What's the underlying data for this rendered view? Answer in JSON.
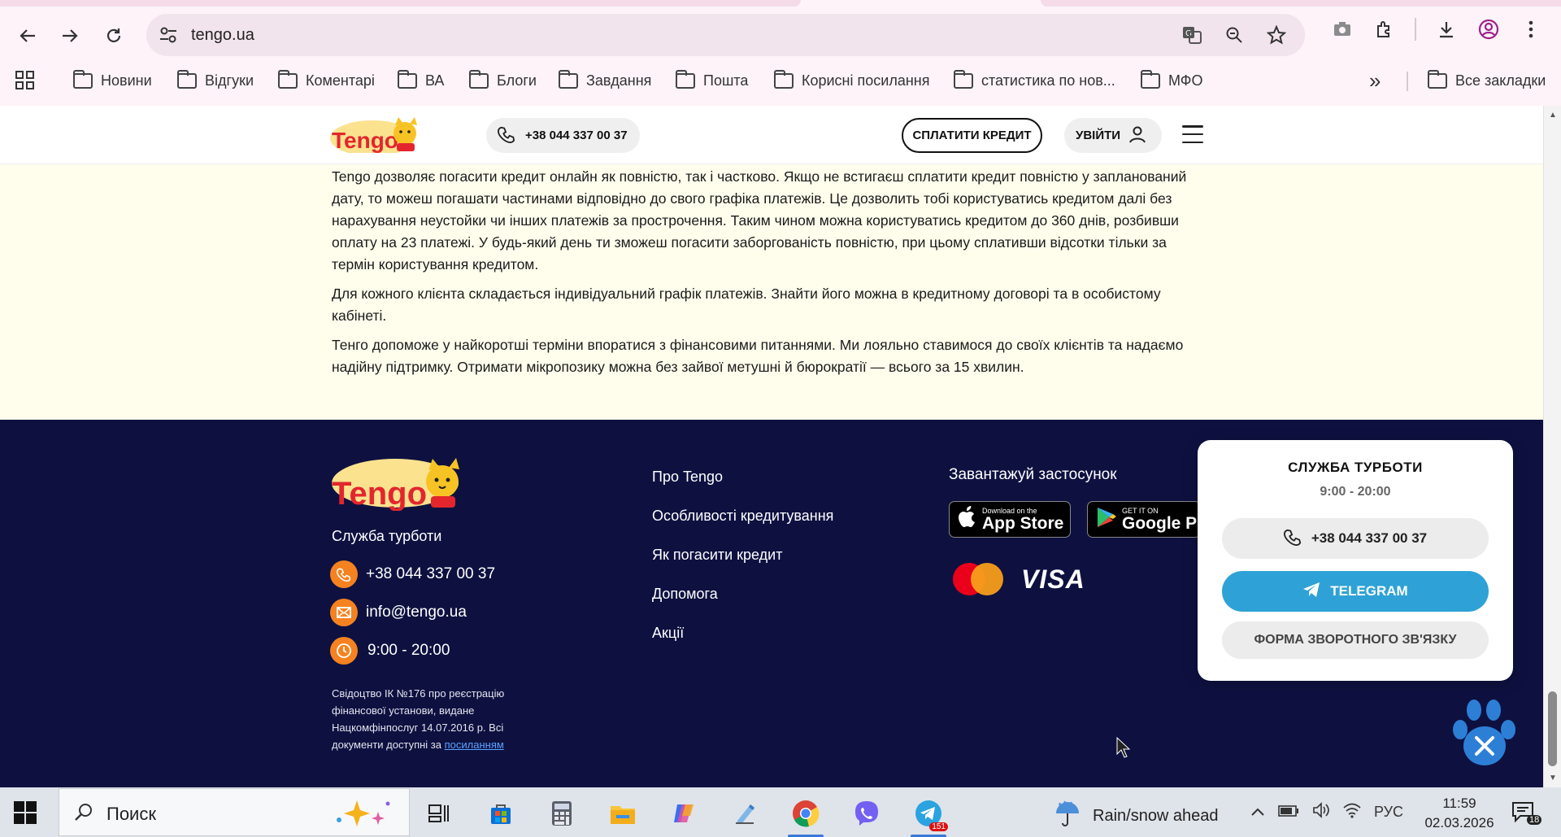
{
  "browser": {
    "url": "tengo.ua",
    "bookmarks": [
      "Новини",
      "Відгуки",
      "Коментарі",
      "ВА",
      "Блоги",
      "Завдання",
      "Пошта",
      "Корисні посилання",
      "статистика по нов...",
      "МФО"
    ],
    "all_bookmarks": "Все закладки"
  },
  "site_header": {
    "phone": "+38 044 337 00 37",
    "pay_button": "СПЛАТИТИ КРЕДИТ",
    "login_button": "УВІЙТИ"
  },
  "article": {
    "paragraphs": [
      "Tengo дозволяє погасити кредит онлайн як повністю, так і частково. Якщо не встигаєш сплатити кредит повністю у запланований дату, то можеш погашати частинами відповідно до свого графіка платежів. Це дозволить тобі користуватись кредитом далі без нарахування неустойки чи інших платежів за прострочення. Таким чином можна користуватись кредитом до 360 днів, розбивши оплату на 23 платежі. У будь-який день ти зможеш погасити заборгованість повністю, при цьому сплативши відсотки тільки за термін користування кредитом.",
      "Для кожного клієнта складається індивідуальний графік платежів. Знайти його можна в кредитному договорі та в особистому кабінеті.",
      "Тенго допоможе у найкоротші терміни впоратися з фінансовими питаннями. Ми лояльно ставимося до своїх клієнтів та надаємо надійну підтримку. Отримати мікропозику можна без зайвої метушні й бюрократії — всього за 15 хвилин."
    ]
  },
  "footer": {
    "care_title": "Служба турботи",
    "phone": "+38 044 337 00 37",
    "email": "info@tengo.ua",
    "hours": "9:00 - 20:00",
    "legal_text": "Свідоцтво ІК №176 про реєстрацію фінансової установи, видане Нацкомфінпослуг 14.07.2016 р. Всі документи доступні за",
    "legal_link": "посиланням",
    "links": [
      "Про Tengo",
      "Особливості кредитування",
      "Як погасити кредит",
      "Допомога",
      "Акції"
    ],
    "app_title": "Завантажуй застосунок",
    "app_store": {
      "small": "Download on the",
      "big": "App Store"
    },
    "google_play": {
      "small": "GET IT ON",
      "big": "Google Play"
    },
    "visa": "VISA"
  },
  "care_popup": {
    "title": "СЛУЖБА ТУРБОТИ",
    "hours": "9:00 - 20:00",
    "phone": "+38 044 337 00 37",
    "telegram": "TELEGRAM",
    "form": "ФОРМА ЗВОРОТНОГО ЗВ'ЯЗКУ"
  },
  "taskbar": {
    "search_placeholder": "Поиск",
    "telegram_badge": "151",
    "weather": "Rain/snow ahead",
    "language": "РУС",
    "time": "11:59",
    "date": "02.03.2026",
    "notifications": "18"
  },
  "colors": {
    "accent_orange": "#f58220",
    "footer_bg": "#0e1140",
    "article_bg": "#fffdec",
    "telegram_blue": "#2ea2d6"
  }
}
